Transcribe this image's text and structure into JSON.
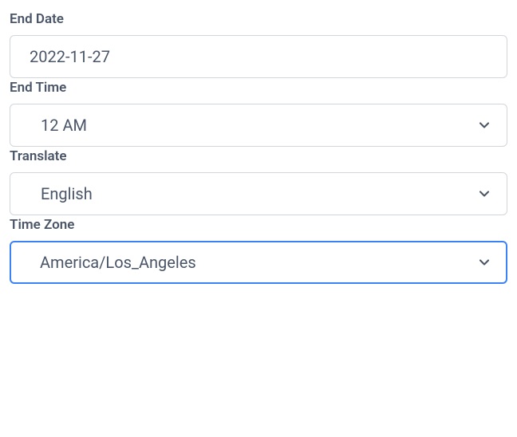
{
  "endDate": {
    "label": "End Date",
    "value": "2022-11-27"
  },
  "endTime": {
    "label": "End Time",
    "value": "12 AM"
  },
  "translate": {
    "label": "Translate",
    "value": "English"
  },
  "timeZone": {
    "label": "Time Zone",
    "value": "America/Los_Angeles"
  }
}
